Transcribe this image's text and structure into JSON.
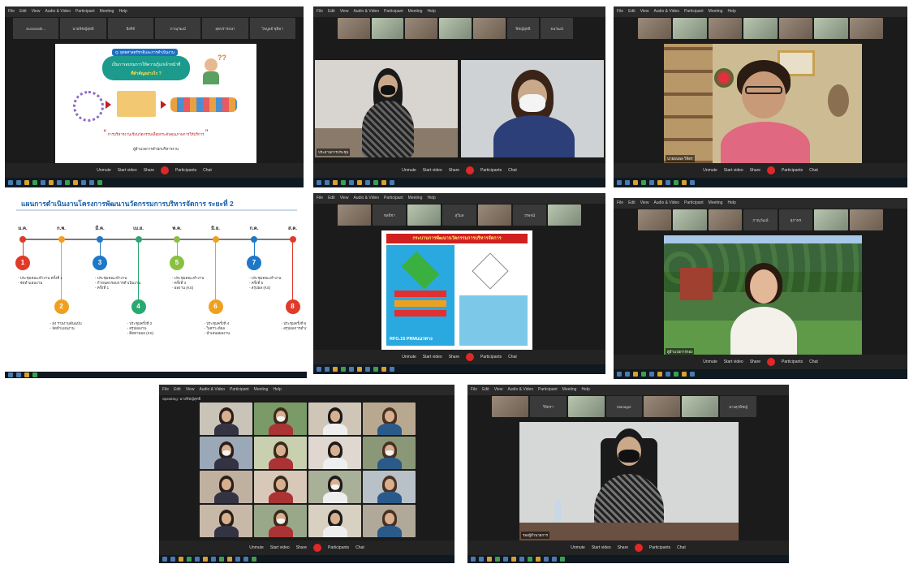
{
  "zoom": {
    "menu": [
      "File",
      "Edit",
      "View",
      "Audio & Video",
      "Participant",
      "Meeting",
      "Help"
    ],
    "toolbar": {
      "unmute": "Unmute",
      "start_video": "Start video",
      "share": "Share",
      "participants": "Participants",
      "chat": "Chat"
    }
  },
  "panels": {
    "p1": {
      "tiles": [
        "SurSarath...",
        "นายพิชญ์สุทธิ",
        "อิสรีย์",
        "ภาณุวัฒน์",
        "สุดปรารถนา",
        "ไพบูลย์ ชุติมา"
      ],
      "slide": {
        "title": "Q: ยุทธศาสตร์ชาติและการดำเนินงาน",
        "heading": "เป็นการอบรมการให้ความรู้แก่เจ้าหน้าที่",
        "subheading": "ที่สำคัญอย่างไร ?",
        "quote": "การบริหารงานเชิงนวัตกรรมเพื่อยกระดับคุณภาพการให้บริการ",
        "footer": "ผู้อำนวยการสำนักบริหารงาน"
      }
    },
    "p2": {
      "tiles": [
        "พิชญ์สุทธิ",
        "ธนวัฒน์"
      ],
      "speaker": "ประธานการประชุม"
    },
    "p3": {
      "speaker": "นายธนพล วิจิตร"
    },
    "p4": {
      "title": "แผนการดำเนินงานโครงการพัฒนานวัตกรรมการบริหารจัดการ ระยะที่ 2",
      "months": [
        "ม.ค.",
        "ก.พ.",
        "มี.ค.",
        "เม.ย.",
        "พ.ค.",
        "มิ.ย.",
        "ก.ค.",
        "ส.ค."
      ],
      "steps": [
        "1",
        "2",
        "3",
        "4",
        "5",
        "6",
        "7",
        "8"
      ],
      "notes_top": [
        "- ประชุมคณะทำงาน ครั้งที่ 1\n- จัดทำแผนงาน",
        "- ประชุมคณะทำงาน\n- กำหนดกรอบการดำเนินงาน\n- ครั้งที่ 1",
        "- ประชุมคณะทำงาน\n- ครั้งที่ 3\n- ผลงาน (KS)",
        "- ประชุมคณะทำงาน\n- ครั้งที่ 5\n- สรุปผล (KS)"
      ],
      "notes_bottom": [
        "- ส่ง รายงานต้นฉบับ\n- จัดทำแผนงาน",
        "- ประชุมครั้งที่ 2\n- สรุปผลงาน\n- ติดตามผล (KS)",
        "- ประชุมครั้งที่ 4\n- วิเคราะห์ผล\n- นำเสนอผลงาน",
        "- ประชุมครั้งที่ 6\n- สรุปผลการดำเนินงาน"
      ]
    },
    "p5": {
      "tiles": [
        "ชลธิชา",
        "สุวิมล",
        "วรพจน์"
      ],
      "slide_title": "กระบวนการพัฒนานวัตกรรมการบริหารจัดการ",
      "slide_sub": "RFG.15 PRMแนวทาง"
    },
    "p6": {
      "tiles": [
        "ภาณุวัฒน์",
        "สุภาพร"
      ],
      "speaker": "ผู้อำนวยการกอง"
    },
    "p7": {
      "header": "Speaking: นางพิชญ์สุทธิ"
    },
    "p8": {
      "tiles": [
        "วิจิตรา",
        "Manager",
        "นางสุวพิชญ์"
      ],
      "speaker": "รองผู้อำนวยการ"
    }
  }
}
